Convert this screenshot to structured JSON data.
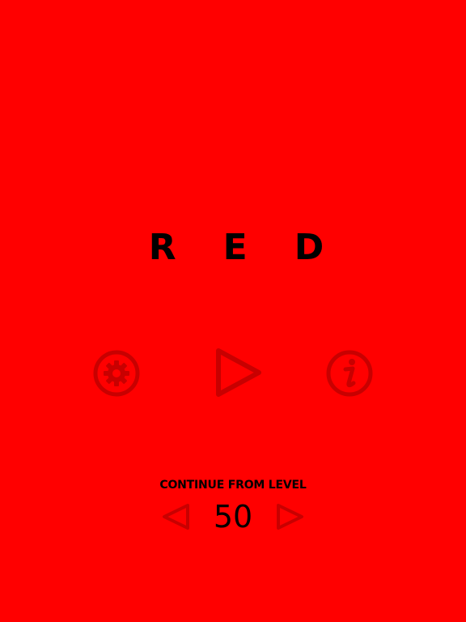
{
  "theme": {
    "background": "#ff0000",
    "text": "#000000",
    "icon": "#c80000"
  },
  "title": {
    "letters": [
      "R",
      "E",
      "D"
    ]
  },
  "controls": {
    "settings_icon": "gear-icon",
    "play_icon": "play-icon",
    "info_icon": "info-icon"
  },
  "level_selector": {
    "label": "CONTINUE FROM LEVEL",
    "level": "50",
    "prev_icon": "triangle-left-icon",
    "next_icon": "triangle-right-icon"
  }
}
